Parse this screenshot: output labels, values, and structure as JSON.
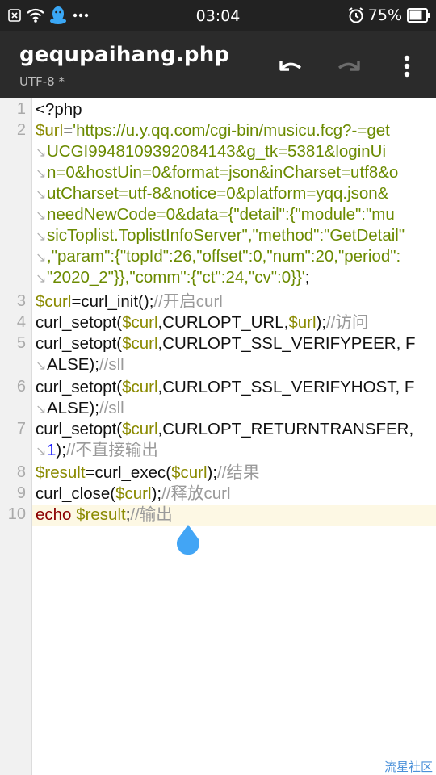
{
  "status_bar": {
    "time": "03:04",
    "battery": "75%",
    "icons": [
      "close-box-icon",
      "wifi-icon",
      "qq-penguin-icon",
      "more-dots-icon",
      "alarm-icon",
      "battery-icon"
    ]
  },
  "app_bar": {
    "title": "gequpaihang.php",
    "subtitle": "UTF-8 *",
    "actions": [
      "undo-icon",
      "redo-icon",
      "overflow-menu-icon"
    ]
  },
  "editor": {
    "line_numbers": [
      "1",
      "2",
      "3",
      "4",
      "5",
      "6",
      "7",
      "8",
      "9",
      "10"
    ],
    "current_line": "10",
    "code": {
      "l1": "<?php",
      "l2_var": "$url",
      "l2_eq": "=",
      "l2_s1": "'https://u.y.qq.com/cgi-bin/musicu.fcg?-=get",
      "l2_s2": "UCGI9948109392084143&g_tk=5381&loginUi",
      "l2_s3": "n=0&hostUin=0&format=json&inCharset=utf8&o",
      "l2_s4": "utCharset=utf-8&notice=0&platform=yqq.json&",
      "l2_s5": "needNewCode=0&data={\"detail\":{\"module\":\"mu",
      "l2_s6": "sicToplist.ToplistInfoServer\",\"method\":\"GetDetail\"",
      "l2_s7": ",\"param\":{\"topId\":26,\"offset\":0,\"num\":20,\"period\":",
      "l2_s8": "\"2020_2\"}},\"comm\":{\"ct\":24,\"cv\":0}}'",
      "l2_end": ";",
      "l3_var": "$curl",
      "l3_rest": "=curl_init();",
      "l3_cmt": "//开启curl",
      "l4_a": "curl_setopt(",
      "l4_var1": "$curl",
      "l4_b": ",CURLOPT_URL,",
      "l4_var2": "$url",
      "l4_c": ");",
      "l4_cmt": "//访问",
      "l5_a": "curl_setopt(",
      "l5_var": "$curl",
      "l5_b": ",CURLOPT_SSL_VERIFYPEER, F",
      "l5_c": "ALSE);",
      "l5_cmt": "//sll",
      "l6_a": "curl_setopt(",
      "l6_var": "$curl",
      "l6_b": ",CURLOPT_SSL_VERIFYHOST, F",
      "l6_c": "ALSE);",
      "l6_cmt": "//sll",
      "l7_a": "curl_setopt(",
      "l7_var": "$curl",
      "l7_b": ",CURLOPT_RETURNTRANSFER,",
      "l7_num": "1",
      "l7_c": ");",
      "l7_cmt": "//不直接输出",
      "l8_var1": "$result",
      "l8_a": "=curl_exec(",
      "l8_var2": "$curl",
      "l8_b": ");",
      "l8_cmt": "//结果",
      "l9_a": "curl_close(",
      "l9_var": "$curl",
      "l9_b": ");",
      "l9_cmt": "//释放curl",
      "l10_kw": "echo",
      "l10_var": "$result",
      "l10_a": ";",
      "l10_cmt": "//输出"
    }
  },
  "watermark": "流星社区",
  "colors": {
    "statusbar_bg": "#222222",
    "appbar_bg": "#2b2b2b",
    "variable": "#8a8a00",
    "string": "#6b8a00",
    "comment": "#9a9a9a",
    "number": "#1a1aff",
    "keyword": "#8b0000",
    "cursor_handle": "#42a5f5"
  }
}
